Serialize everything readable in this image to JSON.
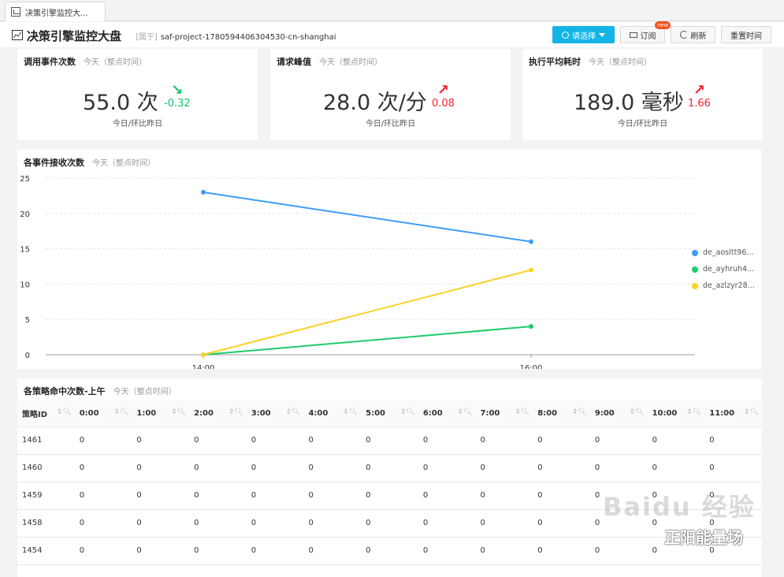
{
  "tab": {
    "label": "决策引擎监控大..."
  },
  "header": {
    "title": "决策引擎监控大盘",
    "belong_prefix": "属于",
    "project": "saf-project-1780594406304530-cn-shanghai",
    "select_label": "请选择",
    "subscribe_label": "订阅",
    "new_badge": "new",
    "refresh_label": "刷新",
    "reset_time_label": "重置时间"
  },
  "stats": [
    {
      "title": "调用事件次数",
      "sub": "今天（整点时间）",
      "value": "55.0 次",
      "delta": "-0.32",
      "trend": "down",
      "note": "今日/环比昨日"
    },
    {
      "title": "请求峰值",
      "sub": "今天（整点时间）",
      "value": "28.0 次/分",
      "delta": "0.08",
      "trend": "up",
      "note": "今日/环比昨日"
    },
    {
      "title": "执行平均耗时",
      "sub": "今天（整点时间）",
      "value": "189.0 毫秒",
      "delta": "1.66",
      "trend": "up",
      "note": "今日/环比昨日"
    }
  ],
  "arrows": {
    "up": "↗",
    "down": "↘"
  },
  "chart_card": {
    "title": "各事件接收次数",
    "sub": "今天（整点时间）"
  },
  "chart_data": {
    "type": "line",
    "x": [
      "14:00",
      "16:00"
    ],
    "ylim": [
      0,
      25
    ],
    "yticks": [
      0,
      5,
      10,
      15,
      20,
      25
    ],
    "grid": true,
    "legend": "right",
    "series": [
      {
        "name": "de_aosltt96...",
        "color": "#3d9cf6",
        "values": [
          23,
          16
        ]
      },
      {
        "name": "de_ayhruh4...",
        "color": "#1fcc6c",
        "values": [
          0,
          4
        ]
      },
      {
        "name": "de_azlzyr28...",
        "color": "#fad22a",
        "values": [
          0,
          12
        ]
      }
    ]
  },
  "table_card": {
    "title": "各策略命中次数-上午",
    "sub": "今天（整点时间）"
  },
  "table": {
    "columns": [
      "策略ID",
      "0:00",
      "1:00",
      "2:00",
      "3:00",
      "4:00",
      "5:00",
      "6:00",
      "7:00",
      "8:00",
      "9:00",
      "10:00",
      "11:00"
    ],
    "rows": [
      [
        "1461",
        "0",
        "0",
        "0",
        "0",
        "0",
        "0",
        "0",
        "0",
        "0",
        "0",
        "0",
        "0"
      ],
      [
        "1460",
        "0",
        "0",
        "0",
        "0",
        "0",
        "0",
        "0",
        "0",
        "0",
        "0",
        "0",
        "0"
      ],
      [
        "1459",
        "0",
        "0",
        "0",
        "0",
        "0",
        "0",
        "0",
        "0",
        "0",
        "0",
        "0",
        "0"
      ],
      [
        "1458",
        "0",
        "0",
        "0",
        "0",
        "0",
        "0",
        "0",
        "0",
        "0",
        "0",
        "0",
        "0"
      ],
      [
        "1454",
        "0",
        "0",
        "0",
        "0",
        "0",
        "0",
        "0",
        "0",
        "0",
        "0",
        "0",
        "0"
      ]
    ]
  },
  "watermark": {
    "logo": "Baidu 经验",
    "text": "正阳能量场"
  }
}
